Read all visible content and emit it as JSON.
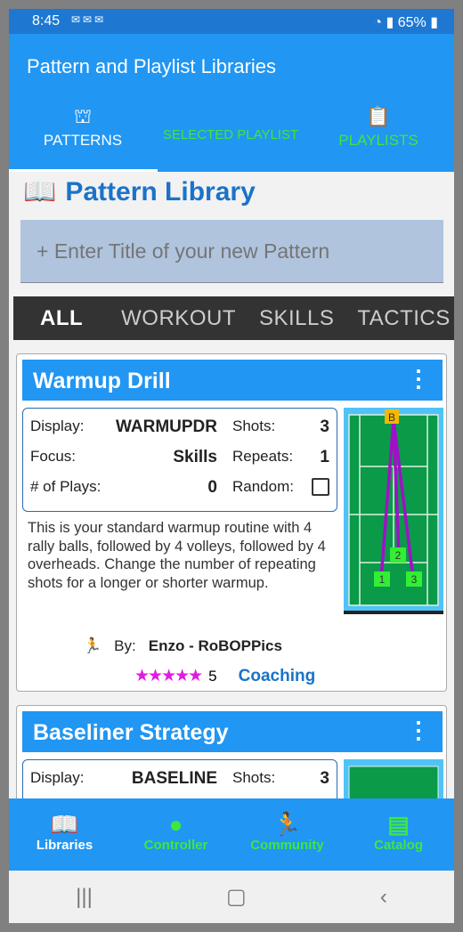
{
  "status": {
    "time": "8:45",
    "battery": "65%"
  },
  "app": {
    "title": "Pattern and Playlist Libraries"
  },
  "tabs": [
    {
      "label": "PATTERNS",
      "icon": "court-icon"
    },
    {
      "label": "SELECTED PLAYLIST"
    },
    {
      "label": "PLAYLISTS",
      "icon": "clipboard-icon"
    }
  ],
  "library": {
    "heading": "Pattern Library",
    "new_placeholder": "+ Enter Title of your new Pattern"
  },
  "filters": [
    "ALL",
    "WORKOUT",
    "SKILLS",
    "TACTICS"
  ],
  "cards": [
    {
      "title": "Warmup Drill",
      "display_label": "Display:",
      "display": "WARMUPDR",
      "shots_label": "Shots:",
      "shots": "3",
      "focus_label": "Focus:",
      "focus": "Skills",
      "repeats_label": "Repeats:",
      "repeats": "1",
      "plays_label": "# of Plays:",
      "plays": "0",
      "random_label": "Random:",
      "random": false,
      "description": "This is your standard warmup routine with 4 rally balls, followed by 4 volleys, followed by 4 overheads. Change the number of repeating shots for a longer or shorter warmup.",
      "by_label": "By:",
      "author": "Enzo - RoBOPPics",
      "stars": "★★★★★",
      "rating": "5",
      "category": "Coaching",
      "court": {
        "ball_marker": "B",
        "shots": [
          "1",
          "2",
          "3"
        ],
        "colors": {
          "court": "#0a9a48",
          "surround": "#4fc3f7",
          "path": "#a010c8",
          "marker": "#f5b800",
          "shot": "#33ee33"
        }
      }
    },
    {
      "title": "Baseliner Strategy",
      "display_label": "Display:",
      "display": "BASELINE",
      "shots_label": "Shots:",
      "shots": "3"
    }
  ],
  "bottom_nav": [
    {
      "label": "Libraries"
    },
    {
      "label": "Controller"
    },
    {
      "label": "Community"
    },
    {
      "label": "Catalog"
    }
  ],
  "colors": {
    "primary": "#2196f3",
    "accent_green": "#3de83d",
    "heading": "#1a73c8"
  }
}
